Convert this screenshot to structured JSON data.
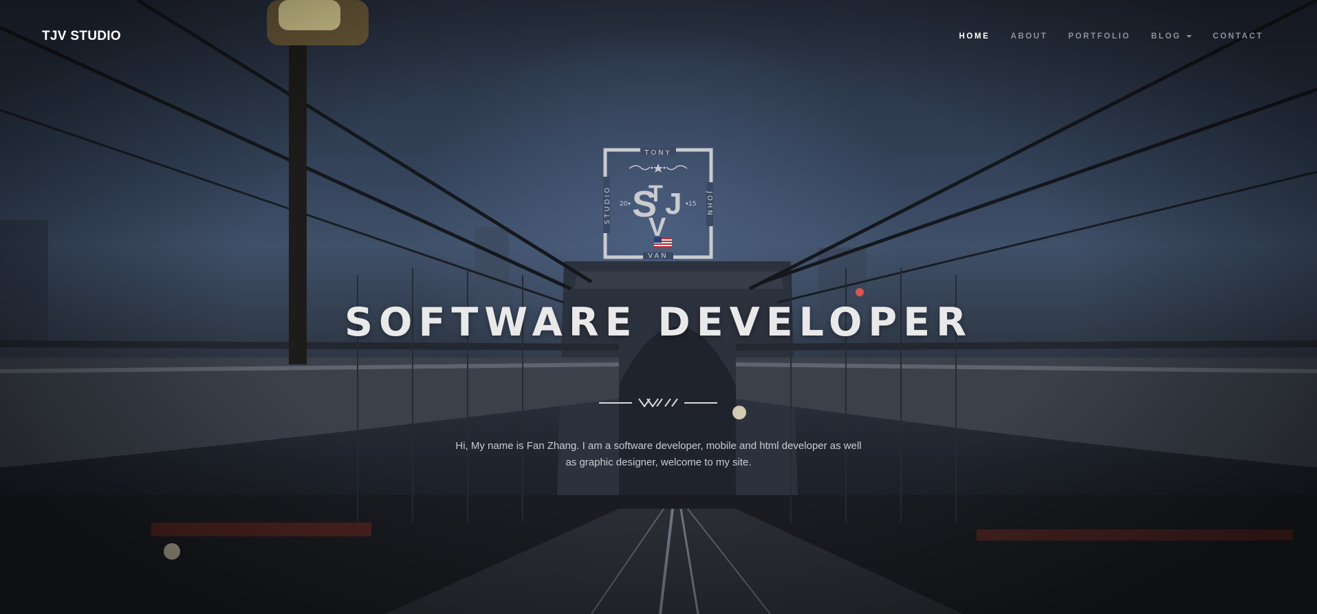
{
  "site": {
    "brand": "TJV STUDIO"
  },
  "nav": {
    "items": [
      {
        "label": "HOME",
        "active": true
      },
      {
        "label": "ABOUT",
        "active": false
      },
      {
        "label": "PORTFOLIO",
        "active": false
      },
      {
        "label": "BLOG",
        "active": false,
        "has_dropdown": true
      },
      {
        "label": "CONTACT",
        "active": false
      }
    ]
  },
  "hero": {
    "logo": {
      "top": "TONY",
      "left": "STUDIO",
      "right": "JOHN",
      "bottom": "VAN",
      "year_left": "20",
      "year_right": "15",
      "monogram_s": "S",
      "monogram_t": "T",
      "monogram_j": "J",
      "monogram_v": "V"
    },
    "headline": "SOFTWARE DEVELOPER",
    "intro": "Hi, My name is Fan Zhang. I am a software developer, mobile and html developer as well as graphic designer, welcome to my site."
  },
  "colors": {
    "accent": "#ffffff",
    "nav_inactive": "#8d929b",
    "sky": "#3f5069"
  },
  "icons": {
    "dropdown": "caret-down-icon",
    "flag": "us-flag-icon"
  }
}
